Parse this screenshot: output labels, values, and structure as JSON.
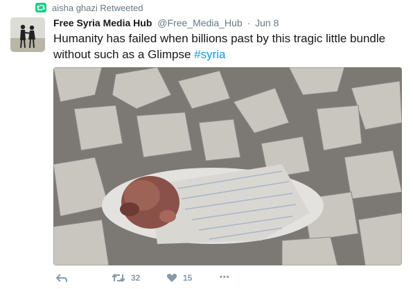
{
  "retweet_context": {
    "text": "aisha ghazi Retweeted"
  },
  "tweet": {
    "author_name": "Free Syria Media Hub",
    "author_handle": "@Free_Media_Hub",
    "separator": "·",
    "timestamp": "Jun 8",
    "text_main": "Humanity has failed when billions past by this tragic little bundle without such as a Glimpse ",
    "hashtag": "#syria"
  },
  "actions": {
    "retweet_count": "32",
    "like_count": "15",
    "more_label": "•••"
  },
  "colors": {
    "accent": "#1b95e0",
    "muted": "#657786",
    "icon": "#8899a6",
    "retweet_green": "#19cf86"
  }
}
